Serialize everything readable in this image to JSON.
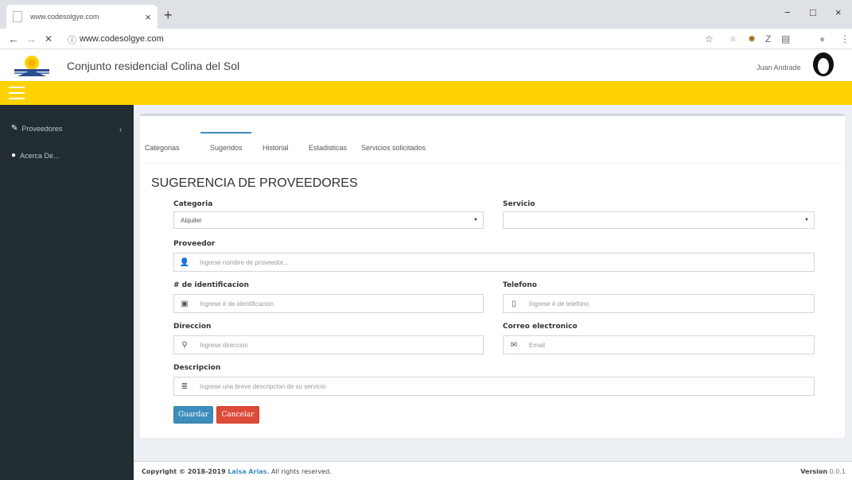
{
  "browser": {
    "tab_title": "www.codesolgye.com",
    "tab_close": "×",
    "new_tab": "+",
    "url": "www.codesolgye.com",
    "win_min": "−",
    "win_max": "□",
    "win_close": "×",
    "back": "←",
    "forward": "→",
    "stop": "✕"
  },
  "header": {
    "title": "Conjunto residencial Colina del Sol",
    "user_name": "Juan Andrade"
  },
  "sidebar": {
    "items": [
      {
        "label": "Proveedores",
        "icon": "wrench-icon"
      },
      {
        "label": "Acerca De...",
        "icon": "info-icon"
      }
    ]
  },
  "tabs": [
    "Categorias",
    "Sugeridos",
    "Historial",
    "Estadisticas",
    "Servicios solicitados"
  ],
  "active_tab": "Sugeridos",
  "form": {
    "title": "SUGERENCIA DE PROVEEDORES",
    "categoria": {
      "label": "Categoria",
      "value": "Alquiler"
    },
    "servicio": {
      "label": "Servicio",
      "value": ""
    },
    "proveedor": {
      "label": "Proveedor",
      "placeholder": "Ingrese nombre de proveedor..."
    },
    "identificacion": {
      "label": "# de identificacion",
      "placeholder": "Ingrese # de identificacion"
    },
    "telefono": {
      "label": "Telefono",
      "placeholder": "Ingrese # de telefono"
    },
    "direccion": {
      "label": "Direccion",
      "placeholder": "Ingrese direccion"
    },
    "correo": {
      "label": "Correo electronico",
      "placeholder": "Email"
    },
    "descripcion": {
      "label": "Descripcion",
      "placeholder": "Ingrese una breve descripcion de su servicio"
    },
    "save_label": "Guardar",
    "cancel_label": "Cancelar"
  },
  "footer": {
    "copyright_prefix": "Copyright © 2018-2019",
    "author": "Laisa Arias.",
    "rights": "All rights reserved.",
    "version_label": "Version",
    "version": "0.0.1"
  },
  "colors": {
    "accent_yellow": "#ffd200",
    "sidebar_bg": "#222d32",
    "primary_blue": "#3c8dbc",
    "danger_red": "#dd4b39"
  }
}
